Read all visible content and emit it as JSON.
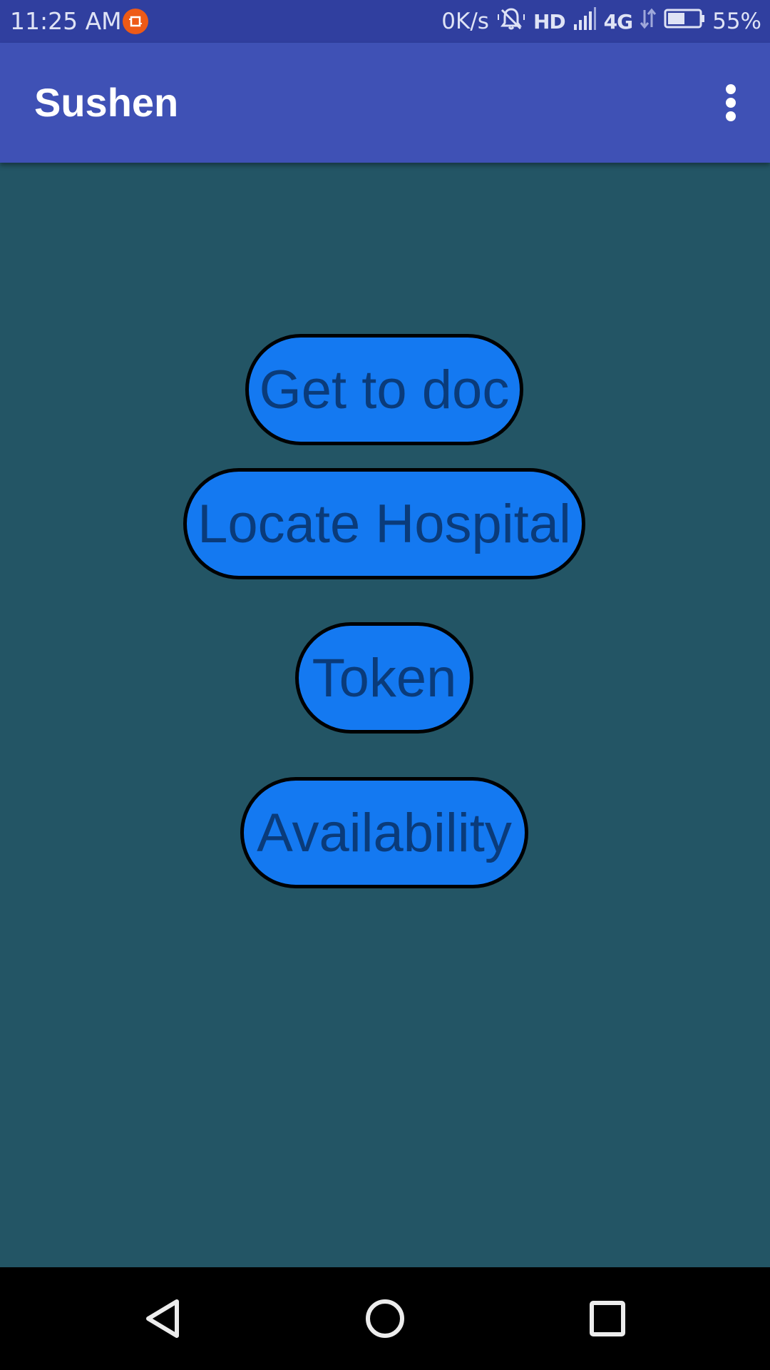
{
  "status_bar": {
    "time": "11:25 AM",
    "net_speed": "0K/s",
    "hd_label": "HD",
    "network_type": "4G",
    "battery_percent": "55%",
    "battery_level": 0.55,
    "notification_icon": "orange-square-notification-icon",
    "ringer_icon": "silent-bell-icon",
    "signal_icon": "signal-bars-icon",
    "data_icon": "data-arrows-icon",
    "battery_icon": "battery-icon"
  },
  "app_bar": {
    "title": "Sushen",
    "menu_icon": "more-vertical-icon",
    "color": "#3f51b5"
  },
  "main": {
    "background": "#235565",
    "buttons": [
      {
        "label": "Get to doc"
      },
      {
        "label": "Locate Hospital"
      },
      {
        "label": "Token"
      },
      {
        "label": "Availability"
      }
    ],
    "button_color": "#1479f1",
    "button_text_color": "#0a3b7a"
  },
  "nav_bar": {
    "back_icon": "back-triangle-icon",
    "home_icon": "home-circle-icon",
    "recents_icon": "recents-square-icon"
  }
}
